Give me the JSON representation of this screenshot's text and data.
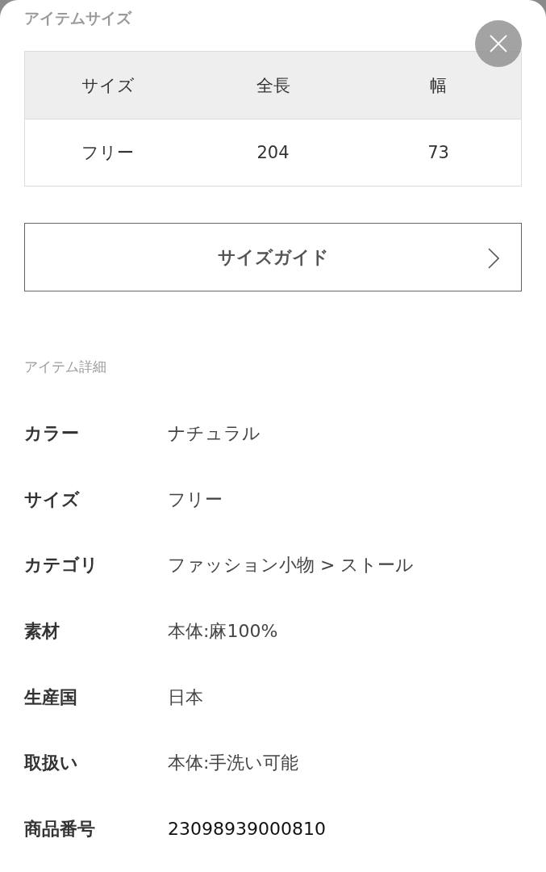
{
  "size_section": {
    "title": "アイテムサイズ",
    "table": {
      "columns": [
        "サイズ",
        "全長",
        "幅"
      ],
      "rows": [
        [
          "フリー",
          "204",
          "73"
        ]
      ]
    },
    "size_guide_button": {
      "label": "サイズガイド"
    }
  },
  "details_section": {
    "title": "アイテム詳細",
    "rows": [
      {
        "label": "カラー",
        "value": "ナチュラル"
      },
      {
        "label": "サイズ",
        "value": "フリー"
      },
      {
        "label": "カテゴリ",
        "value": "ファッション小物 > ストール"
      },
      {
        "label": "素材",
        "value": "本体:麻100%"
      },
      {
        "label": "生産国",
        "value": "日本"
      },
      {
        "label": "取扱い",
        "value": "本体:手洗い可能"
      },
      {
        "label": "商品番号",
        "value": "23098939000810"
      }
    ]
  }
}
